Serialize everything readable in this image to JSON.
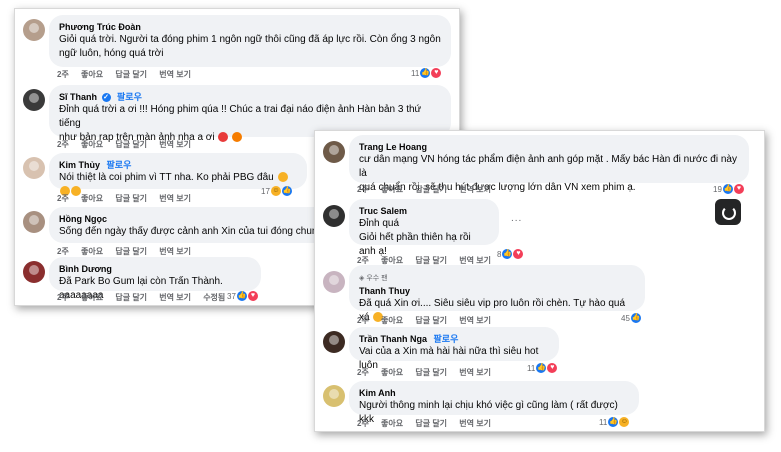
{
  "left": {
    "comments": [
      {
        "name": "Phương Trúc Đoàn",
        "verified": false,
        "follow": "",
        "lines": [
          "Giỏi quá trời. Người ta đóng phim 1 ngôn ngữ thôi cũng đã áp lực rồi. Còn ổng 3 ngôn",
          "ngữ luôn, hóng quá trời"
        ],
        "actions": [
          "2주",
          "좋아요",
          "답글 달기",
          "번역 보기"
        ],
        "count": "11"
      },
      {
        "name": "Sĩ Thanh",
        "verified": true,
        "follow": "팔로우",
        "lines": [
          "Đỉnh quá trời a ơi !!! Hóng phim qúa !! Chúc a trai đại náo điện ảnh Hàn bản 3 thứ tiếng",
          "như bản rap trên màn ảnh nha a ơi"
        ],
        "actions": [
          "2주",
          "좋아요",
          "답글 달기",
          "번역 보기"
        ],
        "count": ""
      },
      {
        "name": "Kim Thủy",
        "verified": false,
        "follow": "팔로우",
        "lines": [
          "Nói thiệt là coi phim vì TT nha. Ko phải PBG đâu"
        ],
        "actions": [
          "2주",
          "좋아요",
          "답글 달기",
          "번역 보기"
        ],
        "count": "17"
      },
      {
        "name": "Hồng Ngọc",
        "verified": false,
        "follow": "",
        "lines": [
          "Sống đến ngày thấy được cảnh anh Xin của tui đóng chung"
        ],
        "actions": [
          "2주",
          "좋아요",
          "답글 달기",
          "번역 보기"
        ],
        "count": ""
      },
      {
        "name": "Bình Dương",
        "verified": false,
        "follow": "",
        "lines": [
          "Đã Park Bo Gum lại còn Trấn Thành. aaaaaaaa"
        ],
        "actions": [
          "2주",
          "좋아요",
          "답글 달기",
          "번역 보기",
          "수정됨"
        ],
        "count": "37"
      }
    ]
  },
  "right": {
    "comments": [
      {
        "name": "Trang Le Hoang",
        "follow": "",
        "badge": "",
        "lines": [
          "cư dân mạng VN hóng tác phẩm điện ảnh anh góp mặt . Mấy bác Hàn đi nước đi này là",
          "quá chuẩn rồi, sẽ thu hút được lượng lớn dân VN xem phim ạ."
        ],
        "actions": [
          "2주",
          "좋아요",
          "답글 달기",
          "번역 보기"
        ],
        "count": "19"
      },
      {
        "name": "Truc Salem",
        "follow": "",
        "badge": "",
        "lines": [
          "Đỉnh quá",
          "Giỏi hết phần thiên hạ rồi anh ạ!"
        ],
        "actions": [
          "2주",
          "좋아요",
          "답글 달기",
          "번역 보기"
        ],
        "count": "8"
      },
      {
        "name": "Thanh Thuy",
        "follow": "",
        "badge": "우수 팬",
        "lines": [
          "Đã quá Xin ơi.... Siêu siêu vip pro luôn rồi chèn. Tự hào quá xá"
        ],
        "actions": [
          "2주",
          "좋아요",
          "답글 달기",
          "번역 보기"
        ],
        "count": "45"
      },
      {
        "name": "Trần Thanh Nga",
        "follow": "팔로우",
        "badge": "",
        "lines": [
          "Vai của a Xin mà hài hài nữa thì siêu hot luôn"
        ],
        "actions": [
          "2주",
          "좋아요",
          "답글 달기",
          "번역 보기"
        ],
        "count": "11"
      },
      {
        "name": "Kim Anh",
        "follow": "",
        "badge": "",
        "lines": [
          "Người thông minh lại chịu khó việc gì cũng làm ( rất được) kkk"
        ],
        "actions": [
          "2주",
          "좋아요",
          "답글 달기",
          "번역 보기"
        ],
        "count": "11"
      }
    ],
    "more": "..."
  }
}
